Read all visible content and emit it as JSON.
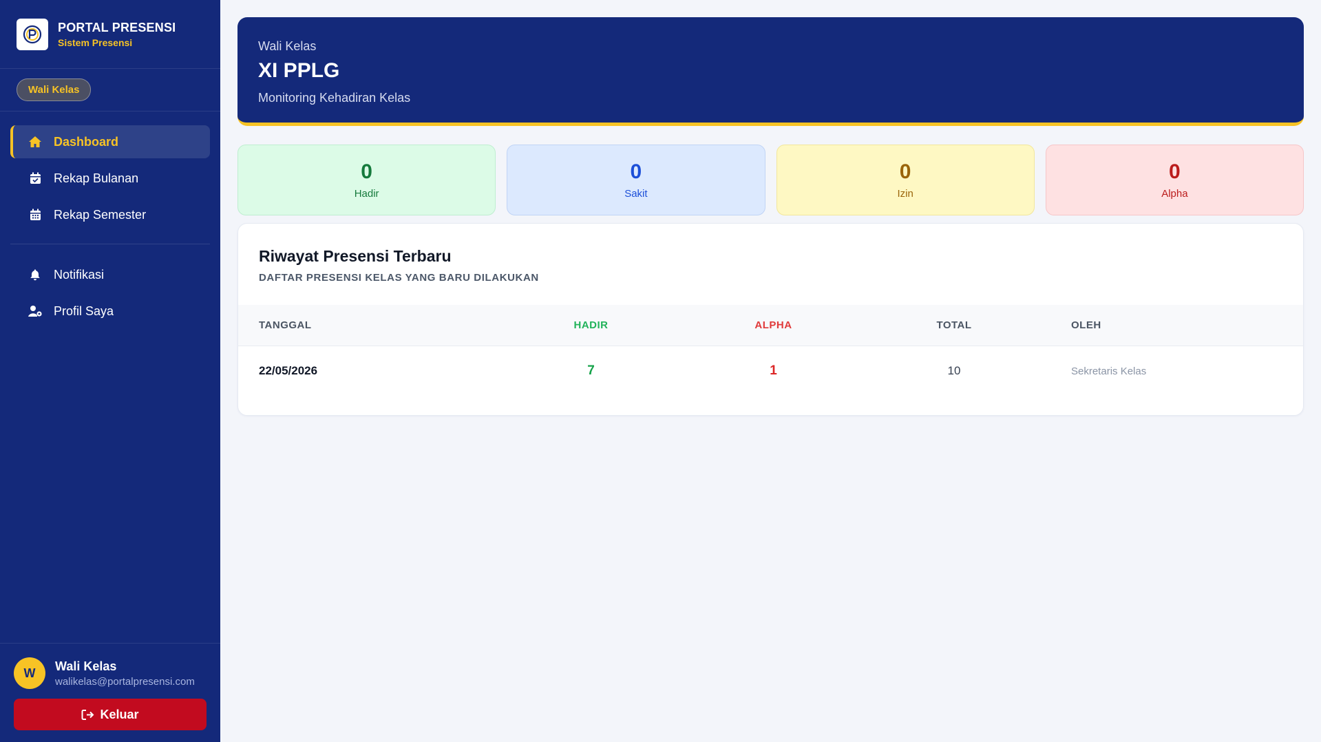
{
  "brand": {
    "title": "PORTAL PRESENSI",
    "subtitle": "Sistem Presensi",
    "logo_icon": "portal-logo-icon"
  },
  "role_badge": "Wali Kelas",
  "nav": {
    "items": [
      {
        "label": "Dashboard",
        "icon": "home-icon",
        "active": true
      },
      {
        "label": "Rekap Bulanan",
        "icon": "calendar-check-icon",
        "active": false
      },
      {
        "label": "Rekap Semester",
        "icon": "calendar-grid-icon",
        "active": false
      },
      {
        "label": "Notifikasi",
        "icon": "bell-icon",
        "active": false
      },
      {
        "label": "Profil Saya",
        "icon": "user-gear-icon",
        "active": false
      }
    ]
  },
  "user": {
    "avatar_letter": "W",
    "name": "Wali Kelas",
    "email": "walikelas@portalpresensi.com"
  },
  "logout_label": "Keluar",
  "hero": {
    "role": "Wali Kelas",
    "class_name": "XI PPLG",
    "description": "Monitoring Kehadiran Kelas"
  },
  "stats": {
    "hadir": {
      "value": "0",
      "label": "Hadir"
    },
    "sakit": {
      "value": "0",
      "label": "Sakit"
    },
    "izin": {
      "value": "0",
      "label": "Izin"
    },
    "alpha": {
      "value": "0",
      "label": "Alpha"
    }
  },
  "history": {
    "title": "Riwayat Presensi Terbaru",
    "subtitle": "DAFTAR PRESENSI KELAS YANG BARU DILAKUKAN",
    "columns": {
      "tanggal": "TANGGAL",
      "hadir": "HADIR",
      "alpha": "ALPHA",
      "total": "TOTAL",
      "oleh": "OLEH"
    },
    "rows": [
      {
        "tanggal": "22/05/2026",
        "hadir": "7",
        "alpha": "1",
        "total": "10",
        "oleh": "Sekretaris Kelas"
      }
    ]
  },
  "colors": {
    "sidebar": "#14297a",
    "accent": "#f7c325",
    "logout": "#c20b1f"
  }
}
